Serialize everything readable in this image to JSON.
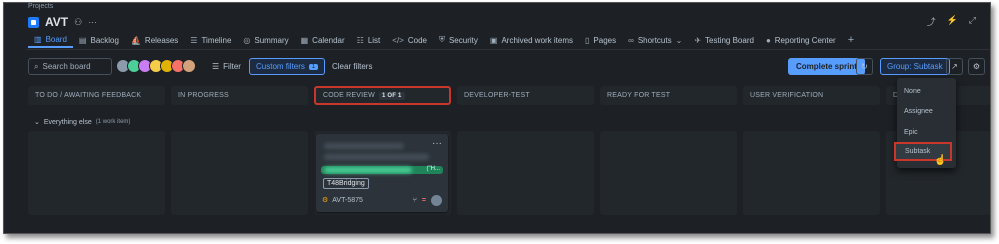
{
  "breadcrumb": "Projects",
  "project": {
    "name": "AVT"
  },
  "tabs": [
    {
      "label": "Board",
      "icon": "board-icon",
      "active": true
    },
    {
      "label": "Backlog",
      "icon": "backlog-icon"
    },
    {
      "label": "Releases",
      "icon": "releases-icon"
    },
    {
      "label": "Timeline",
      "icon": "timeline-icon"
    },
    {
      "label": "Summary",
      "icon": "summary-icon"
    },
    {
      "label": "Calendar",
      "icon": "calendar-icon"
    },
    {
      "label": "List",
      "icon": "list-icon"
    },
    {
      "label": "Code",
      "icon": "code-icon"
    },
    {
      "label": "Security",
      "icon": "security-icon"
    },
    {
      "label": "Archived work items",
      "icon": "archive-icon"
    },
    {
      "label": "Pages",
      "icon": "pages-icon"
    },
    {
      "label": "Shortcuts",
      "icon": "link-icon"
    },
    {
      "label": "Testing Board",
      "icon": "testing-board-icon"
    },
    {
      "label": "Reporting Center",
      "icon": "reporting-center-icon"
    }
  ],
  "toolbar": {
    "search_placeholder": "Search board",
    "filter_label": "Filter",
    "custom_filters_label": "Custom filters",
    "custom_filters_count": "1",
    "clear_filters_label": "Clear filters",
    "complete_sprint_label": "Complete sprint",
    "group_label": "Group: Subtask"
  },
  "columns": [
    {
      "title": "TO DO / AWAITING FEEDBACK"
    },
    {
      "title": "IN PROGRESS"
    },
    {
      "title": "CODE REVIEW",
      "badge": "1 OF 1"
    },
    {
      "title": "DEVELOPER-TEST"
    },
    {
      "title": "READY FOR TEST"
    },
    {
      "title": "USER VERIFICATION"
    },
    {
      "title": "D"
    }
  ],
  "swimlane": {
    "title": "Everything else",
    "count": "(1 work item)"
  },
  "card": {
    "tag": "(\"H...",
    "label": "T48Bridging",
    "key": "AVT-5875"
  },
  "dropdown": {
    "items": [
      "None",
      "Assignee",
      "Epic",
      "Subtask"
    ],
    "selected": "Subtask"
  },
  "colors": {
    "accent": "#579dff",
    "highlight_border": "#c9372c",
    "background": "#1d2125"
  }
}
